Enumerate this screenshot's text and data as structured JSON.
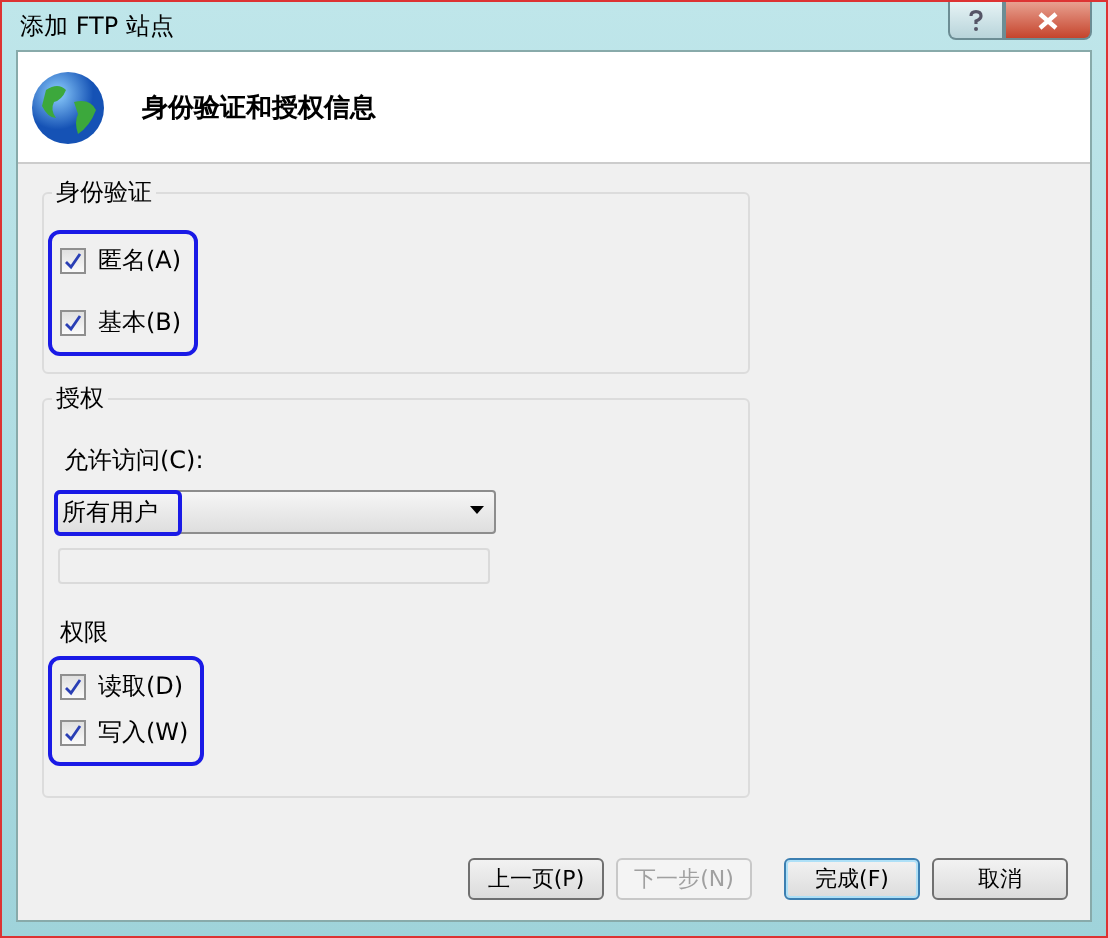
{
  "window": {
    "title": "添加 FTP 站点"
  },
  "header": {
    "title": "身份验证和授权信息"
  },
  "authentication": {
    "title": "身份验证",
    "options": [
      {
        "label": "匿名(A)",
        "checked": true
      },
      {
        "label": "基本(B)",
        "checked": true
      }
    ]
  },
  "authorization": {
    "title": "授权",
    "access_label": "允许访问(C):",
    "access_value": "所有用户",
    "permissions_title": "权限",
    "permissions": [
      {
        "label": "读取(D)",
        "checked": true
      },
      {
        "label": "写入(W)",
        "checked": true
      }
    ]
  },
  "buttons": [
    {
      "label": "上一页(P)",
      "disabled": false,
      "default": false
    },
    {
      "label": "下一步(N)",
      "disabled": true,
      "default": false
    },
    {
      "label": "完成(F)",
      "disabled": false,
      "default": true
    },
    {
      "label": "取消",
      "disabled": false,
      "default": false
    }
  ]
}
